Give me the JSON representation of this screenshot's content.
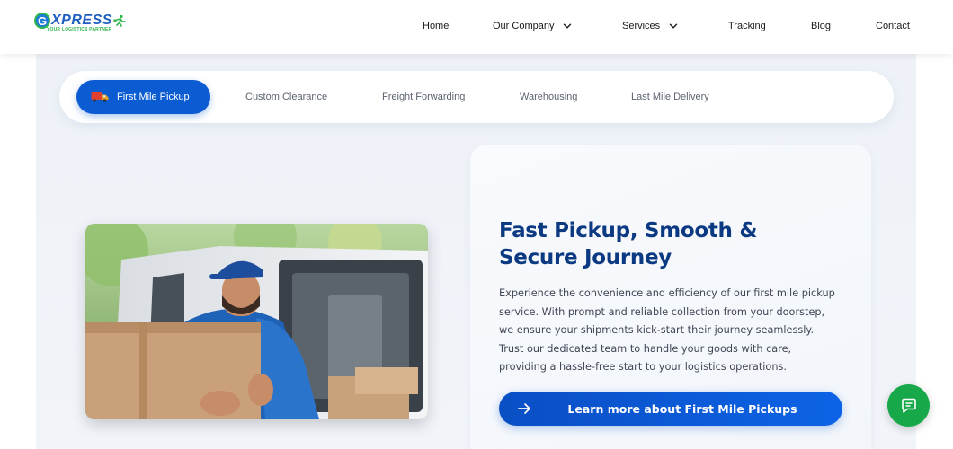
{
  "brand": {
    "logo_text": "XPRESS",
    "tagline": "YOUR LOGISTICS PARTNER",
    "primary_color": "#0b5bd3",
    "accent_color": "#17a84a"
  },
  "nav": {
    "items": [
      {
        "label": "Home"
      },
      {
        "label": "Our Company",
        "dropdown": true
      },
      {
        "label": "Services",
        "dropdown": true
      },
      {
        "label": "Tracking"
      },
      {
        "label": "Blog"
      },
      {
        "label": "Contact"
      }
    ]
  },
  "tabs": {
    "active": {
      "label": "First Mile Pickup",
      "icon": "truck-icon"
    },
    "others": [
      {
        "label": "Custom Clearance"
      },
      {
        "label": "Freight Forwarding"
      },
      {
        "label": "Warehousing"
      },
      {
        "label": "Last Mile Delivery"
      }
    ]
  },
  "content": {
    "title": "Fast Pickup, Smooth & Secure Journey",
    "body": "Experience the convenience and efficiency of our first mile pickup service. With prompt and reliable collection from your doorstep, we ensure your shipments kick-start their journey seamlessly. Trust our dedicated team to handle your goods with care, providing a hassle-free start to your logistics operations.",
    "cta_label": "Learn more about First Mile Pickups",
    "cta_icon": "arrow-right-icon"
  },
  "chat": {
    "icon": "chat-bubble-icon"
  }
}
